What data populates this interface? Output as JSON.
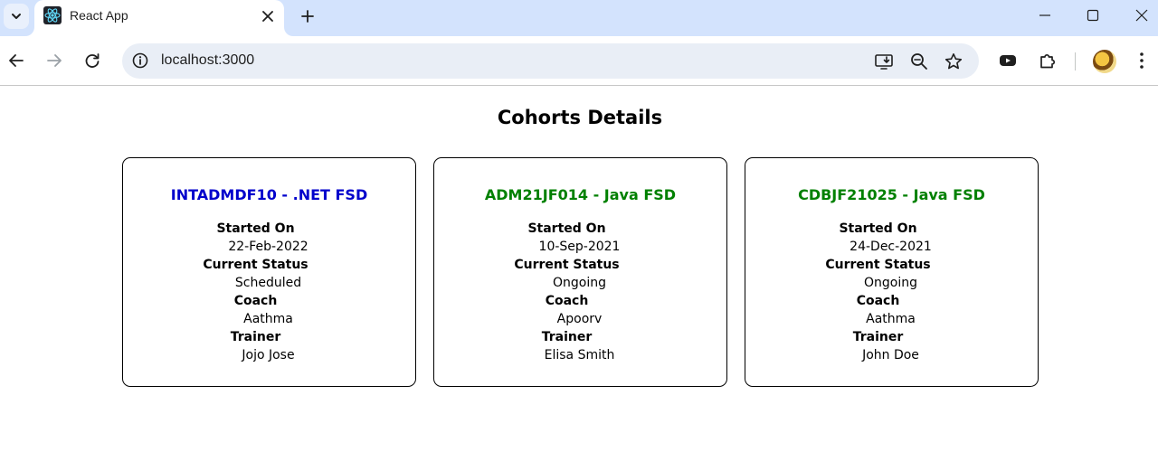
{
  "browser": {
    "tab_title": "React App",
    "url": "localhost:3000"
  },
  "page": {
    "title": "Cohorts Details"
  },
  "labels": {
    "started_on": "Started On",
    "current_status": "Current Status",
    "coach": "Coach",
    "trainer": "Trainer"
  },
  "cohorts": [
    {
      "title": "INTADMDF10 - .NET FSD",
      "title_color": "#0000cc",
      "started_on": "22-Feb-2022",
      "current_status": "Scheduled",
      "coach": "Aathma",
      "trainer": "Jojo Jose"
    },
    {
      "title": "ADM21JF014 - Java FSD",
      "title_color": "#008000",
      "started_on": "10-Sep-2021",
      "current_status": "Ongoing",
      "coach": "Apoorv",
      "trainer": "Elisa Smith"
    },
    {
      "title": "CDBJF21025 - Java FSD",
      "title_color": "#008000",
      "started_on": "24-Dec-2021",
      "current_status": "Ongoing",
      "coach": "Aathma",
      "trainer": "John Doe"
    }
  ],
  "icons": {
    "tab_search": "chevron-down-icon",
    "favicon": "react-logo-icon",
    "tab_close": "close-icon",
    "new_tab": "plus-icon",
    "minimize": "minimize-icon",
    "maximize": "maximize-icon",
    "window_close": "close-icon",
    "back": "back-arrow-icon",
    "forward": "forward-arrow-icon",
    "reload": "reload-icon",
    "site_info": "info-icon",
    "install": "install-app-icon",
    "zoom": "zoom-out-icon",
    "bookmark": "star-icon",
    "media": "media-control-icon",
    "extensions": "puzzle-icon",
    "profile": "avatar",
    "menu": "kebab-menu-icon"
  }
}
